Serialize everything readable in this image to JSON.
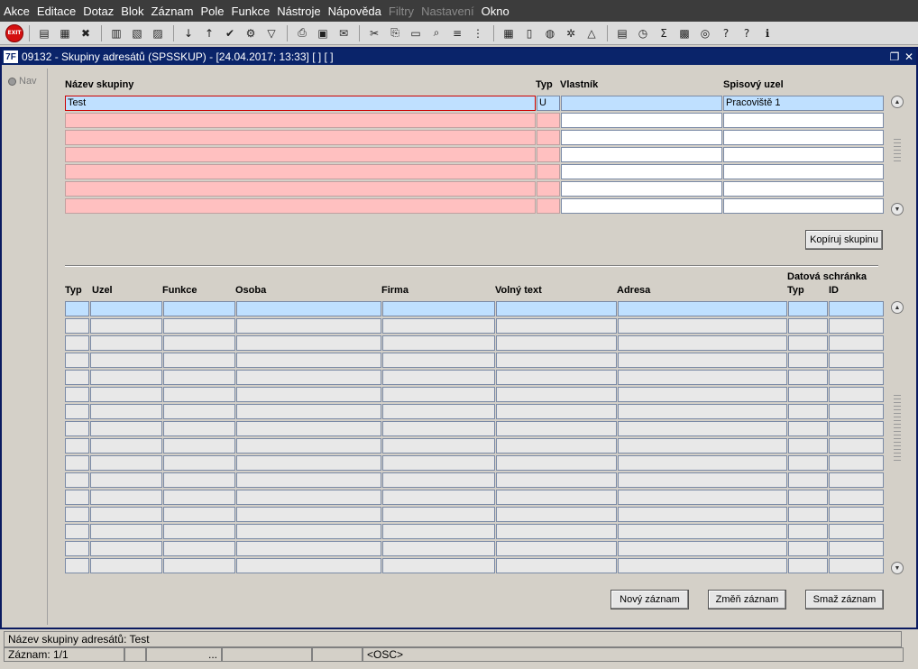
{
  "menu": [
    "Akce",
    "Editace",
    "Dotaz",
    "Blok",
    "Záznam",
    "Pole",
    "Funkce",
    "Nástroje",
    "Nápověda",
    "Filtry",
    "Nastavení",
    "Okno"
  ],
  "menu_disabled": [
    "Filtry",
    "Nastavení"
  ],
  "toolbar": {
    "exit_label": "EXIT"
  },
  "window": {
    "title": "09132 - Skupiny adresátů (SPSSKUP) - [24.04.2017; 13:33]  [ ] [ ]",
    "app_icon": "7F"
  },
  "nav": {
    "label": "Nav"
  },
  "groups": {
    "headers": {
      "name": "Název skupiny",
      "type": "Typ",
      "owner": "Vlastník",
      "registry": "Spisový uzel"
    },
    "rows": [
      {
        "name": "Test",
        "type": "U",
        "owner": "",
        "registry": "Pracoviště 1"
      },
      {
        "name": "",
        "type": "",
        "owner": "",
        "registry": ""
      },
      {
        "name": "",
        "type": "",
        "owner": "",
        "registry": ""
      },
      {
        "name": "",
        "type": "",
        "owner": "",
        "registry": ""
      },
      {
        "name": "",
        "type": "",
        "owner": "",
        "registry": ""
      },
      {
        "name": "",
        "type": "",
        "owner": "",
        "registry": ""
      },
      {
        "name": "",
        "type": "",
        "owner": "",
        "registry": ""
      }
    ],
    "copy_button": "Kopíruj skupinu"
  },
  "members": {
    "headers": {
      "type": "Typ",
      "node": "Uzel",
      "function": "Funkce",
      "person": "Osoba",
      "company": "Firma",
      "free_text": "Volný text",
      "address": "Adresa",
      "databox": "Datová schránka",
      "databox_type": "Typ",
      "databox_id": "ID"
    },
    "row_count": 16
  },
  "buttons": {
    "new": "Nový záznam",
    "edit": "Změň záznam",
    "delete": "Smaž záznam"
  },
  "status": {
    "message": "Název skupiny adresátů: Test",
    "record": "Záznam: 1/1",
    "dots": "...",
    "mode": "<OSC>"
  },
  "colors": {
    "title_bar": "#0a246a",
    "menu_bg": "#3c3c3c",
    "required_field": "#ffc0c0",
    "current_row": "#bfe0ff"
  }
}
